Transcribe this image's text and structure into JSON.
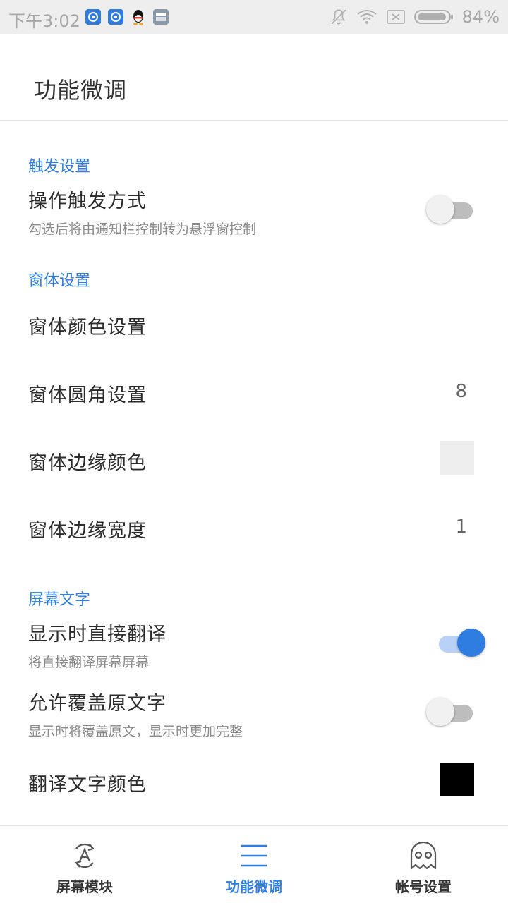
{
  "status_bar": {
    "time": "下午3:02",
    "battery": "84%"
  },
  "header": {
    "title": "功能微调"
  },
  "sections": {
    "trigger": {
      "header": "触发设置",
      "operation_trigger": {
        "title": "操作触发方式",
        "subtitle": "勾选后将由通知栏控制转为悬浮窗控制",
        "enabled": false
      }
    },
    "window": {
      "header": "窗体设置",
      "color_setting": {
        "title": "窗体颜色设置"
      },
      "corner_radius": {
        "title": "窗体圆角设置",
        "value": "8"
      },
      "border_color": {
        "title": "窗体边缘颜色",
        "color": "#eeeeee"
      },
      "border_width": {
        "title": "窗体边缘宽度",
        "value": "1"
      }
    },
    "screen_text": {
      "header": "屏幕文字",
      "direct_translate": {
        "title": "显示时直接翻译",
        "subtitle": "将直接翻译屏幕屏幕",
        "enabled": true
      },
      "allow_cover": {
        "title": "允许覆盖原文字",
        "subtitle": "显示时将覆盖原文，显示时更加完整",
        "enabled": false
      },
      "text_color": {
        "title": "翻译文字颜色",
        "color": "#000000"
      }
    }
  },
  "bottom_nav": {
    "items": [
      {
        "label": "屏幕模块",
        "icon": "translate-icon",
        "active": false
      },
      {
        "label": "功能微调",
        "icon": "menu-icon",
        "active": true
      },
      {
        "label": "帐号设置",
        "icon": "ghost-icon",
        "active": false
      }
    ]
  },
  "colors": {
    "accent": "#2f7de1",
    "toggle_off_track": "#bdbdbd",
    "toggle_on_track": "#b9d1f6"
  }
}
